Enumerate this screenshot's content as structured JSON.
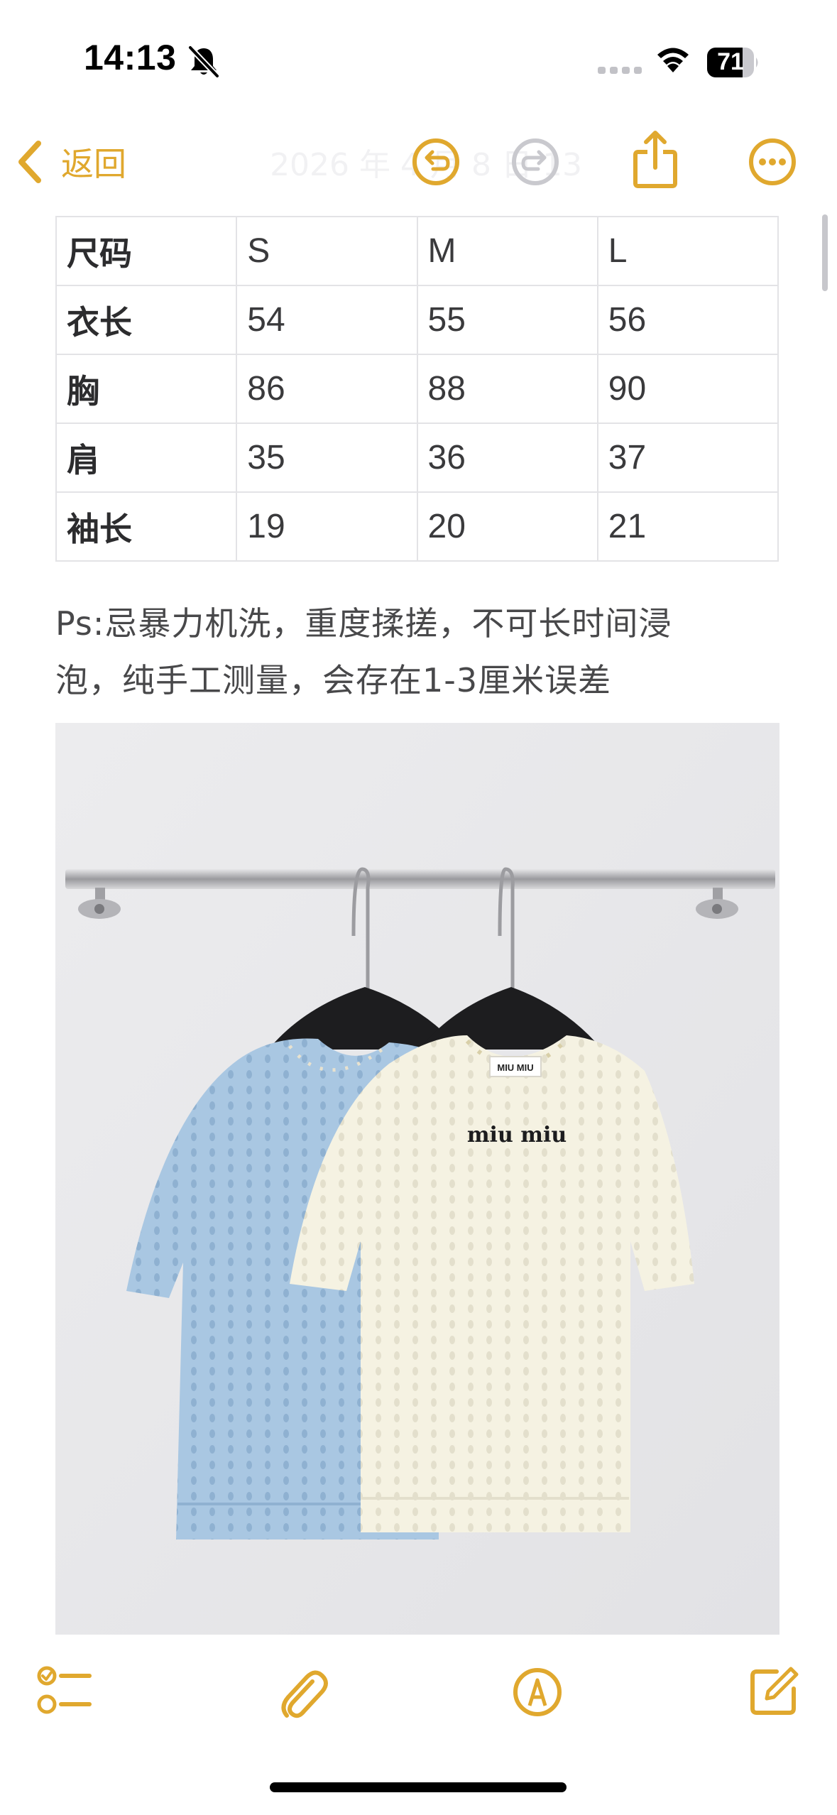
{
  "status_bar": {
    "time": "14:13",
    "battery": "71",
    "icons": [
      "bell-slash-icon",
      "cellular-signal-icon",
      "wifi-icon",
      "battery-icon"
    ]
  },
  "nav": {
    "back_label": "返回",
    "title": "2026 年 4 月 8 日 13",
    "icons": [
      "chevron-left-icon",
      "undo-icon",
      "redo-icon",
      "share-icon",
      "more-icon"
    ]
  },
  "size_table": {
    "header": [
      "尺码",
      "S",
      "M",
      "L"
    ],
    "rows": [
      [
        "衣长",
        "54",
        "55",
        "56"
      ],
      [
        "胸",
        "86",
        "88",
        "90"
      ],
      [
        "肩",
        "35",
        "36",
        "37"
      ],
      [
        "袖长",
        "19",
        "20",
        "21"
      ]
    ]
  },
  "note": {
    "line1": "Ps:忌暴力机洗，重度揉搓，不可长时间浸",
    "line2": "泡，纯手工测量，会存在1-3厘米误差"
  },
  "photo": {
    "brand_text": "miu miu",
    "label_text": "MIU MIU"
  },
  "toolbar": {
    "icons": [
      "checklist-icon",
      "paperclip-icon",
      "markup-pen-icon",
      "compose-icon"
    ]
  },
  "colors": {
    "accent": "#e0a82e",
    "text_primary": "#1c1c1e",
    "text_note": "#48484a",
    "table_border": "#e3e3e6",
    "sweater_blue": "#aac8e3",
    "sweater_cream": "#f6f3e4"
  }
}
